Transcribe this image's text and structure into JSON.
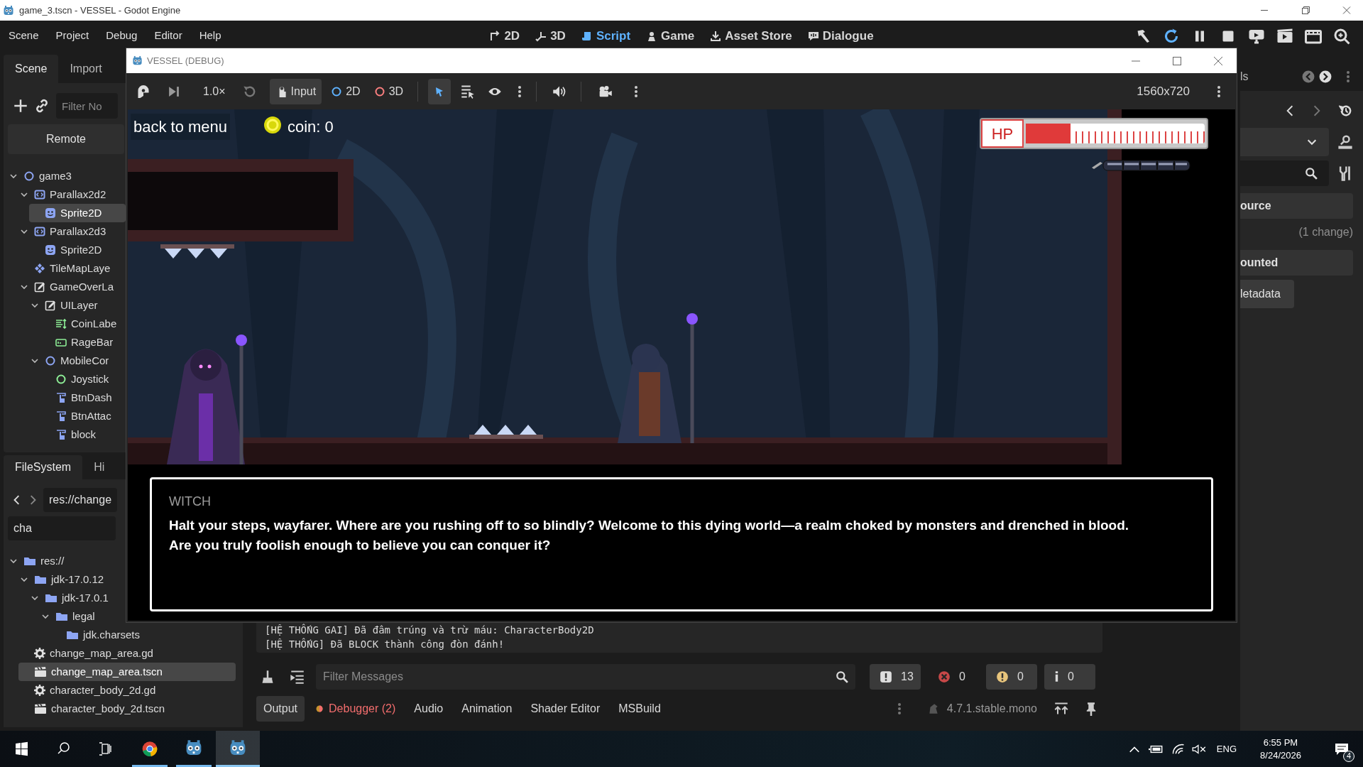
{
  "window": {
    "title": "game_3.tscn - VESSEL - Godot Engine"
  },
  "menu": [
    "Scene",
    "Project",
    "Debug",
    "Editor",
    "Help"
  ],
  "workspaces": [
    {
      "label": "2D",
      "kind": "flat",
      "selected": false
    },
    {
      "label": "3D",
      "kind": "space",
      "selected": false
    },
    {
      "label": "Script",
      "kind": "script",
      "selected": true
    },
    {
      "label": "Game",
      "kind": "game",
      "selected": false
    },
    {
      "label": "Asset Store",
      "kind": "store",
      "selected": false
    },
    {
      "label": "Dialogue",
      "kind": "dialogue",
      "selected": false
    }
  ],
  "scene_dock": {
    "tabs": [
      {
        "label": "Scene",
        "selected": true
      },
      {
        "label": "Import",
        "selected": false
      }
    ],
    "filter": {
      "placeholder": "Filter No"
    },
    "remote_button": "Remote",
    "tree": [
      {
        "label": "game3",
        "kind": "node2d",
        "selected": false,
        "expanded": true,
        "children": [
          {
            "label": "Parallax2d2",
            "kind": "parallax",
            "selected": false,
            "expanded": true,
            "children": [
              {
                "label": "Sprite2D",
                "kind": "sprite",
                "selected": true
              }
            ]
          },
          {
            "label": "Parallax2d3",
            "kind": "parallax",
            "selected": false,
            "expanded": true,
            "children": [
              {
                "label": "Sprite2D",
                "kind": "sprite",
                "selected": false
              }
            ]
          },
          {
            "label": "TileMapLaye",
            "kind": "tilemap",
            "selected": false
          },
          {
            "label": "GameOverLa",
            "kind": "canvas_layer",
            "selected": false,
            "expanded": true,
            "children": [
              {
                "label": "UILayer",
                "kind": "canvas_layer",
                "selected": false,
                "expanded": true,
                "children": [
                  {
                    "label": "CoinLabe",
                    "kind": "label",
                    "selected": false
                  },
                  {
                    "label": "RageBar",
                    "kind": "progress",
                    "selected": false
                  }
                ]
              },
              {
                "label": "MobileCor",
                "kind": "node2d",
                "selected": false,
                "expanded": true,
                "children": [
                  {
                    "label": "Joystick",
                    "kind": "control",
                    "selected": false
                  },
                  {
                    "label": "BtnDash",
                    "kind": "touch_button",
                    "selected": false
                  },
                  {
                    "label": "BtnAttac",
                    "kind": "touch_button",
                    "selected": false
                  },
                  {
                    "label": "block",
                    "kind": "touch_button",
                    "selected": false
                  }
                ]
              }
            ]
          }
        ]
      }
    ]
  },
  "filesystem": {
    "tabs": [
      {
        "label": "FileSystem",
        "selected": true
      },
      {
        "label": "Hi",
        "selected": false
      }
    ],
    "path": "res://change",
    "search": "cha",
    "tree": [
      {
        "label": "res://",
        "kind": "folder",
        "selected": false,
        "expanded": true,
        "children": [
          {
            "label": "jdk-17.0.12",
            "kind": "folder",
            "selected": false,
            "expanded": true,
            "children": [
              {
                "label": "jdk-17.0.1",
                "kind": "folder",
                "selected": false,
                "expanded": true,
                "children": [
                  {
                    "label": "legal",
                    "kind": "folder",
                    "selected": false,
                    "expanded": true,
                    "children": [
                      {
                        "label": "jdk.charsets",
                        "kind": "folder",
                        "selected": false
                      }
                    ]
                  }
                ]
              }
            ]
          },
          {
            "label": "change_map_area.gd",
            "kind": "script",
            "selected": false
          },
          {
            "label": "change_map_area.tscn",
            "kind": "scene",
            "selected": true
          },
          {
            "label": "character_body_2d.gd",
            "kind": "script",
            "selected": false
          },
          {
            "label": "character_body_2d.tscn",
            "kind": "scene",
            "selected": false
          }
        ]
      }
    ]
  },
  "debug_window": {
    "title": "VESSEL (DEBUG)",
    "toolbar": {
      "speed": "1.0×",
      "input_button": "Input",
      "mode_2d": "2D",
      "mode_3d": "3D",
      "resolution": "1560x720"
    },
    "game": {
      "back_button": "back to menu",
      "coin_label": "coin: 0",
      "hp": {
        "label": "HP",
        "level": 0.25
      },
      "dialogue": {
        "speaker": "WITCH",
        "text": "Halt your steps, wayfarer. Where are you rushing off to so blindly? Welcome to this dying world—a realm choked by monsters and drenched in blood. Are you truly foolish enough to believe you can conquer it?"
      }
    }
  },
  "output": {
    "log": [
      "[HỆ THỐNG GAI] Đã đâm trúng và trừ máu: CharacterBody2D",
      "[HỆ THỐNG] Đã BLOCK thành công đòn đánh!"
    ],
    "filter": {
      "placeholder": "Filter Messages"
    },
    "counters": [
      {
        "kind": "message",
        "count": "13",
        "on": true
      },
      {
        "kind": "error",
        "count": "0",
        "on": false
      },
      {
        "kind": "warning",
        "count": "0",
        "on": true
      },
      {
        "kind": "info",
        "count": "0",
        "on": true
      }
    ],
    "tabs": [
      {
        "label": "Output",
        "selected": true,
        "alert": false
      },
      {
        "label": "Debugger (2)",
        "selected": false,
        "alert": true
      },
      {
        "label": "Audio",
        "selected": false,
        "alert": false
      },
      {
        "label": "Animation",
        "selected": false,
        "alert": false
      },
      {
        "label": "Shader Editor",
        "selected": false,
        "alert": false
      },
      {
        "label": "MSBuild",
        "selected": false,
        "alert": false
      }
    ],
    "version": "4.7.1.stable.mono"
  },
  "right_dock": {
    "tab": "ls",
    "sections": [
      {
        "kind": "header",
        "text": "ource"
      },
      {
        "kind": "note",
        "text": "(1 change)"
      },
      {
        "kind": "header",
        "text": "ounted"
      },
      {
        "kind": "button",
        "text": "letadata"
      }
    ]
  },
  "taskbar": {
    "apps": [
      {
        "kind": "chrome",
        "selected": false
      },
      {
        "kind": "godot",
        "selected": false
      },
      {
        "kind": "godot",
        "selected": true
      }
    ],
    "language": "ENG",
    "time": "6:55 PM",
    "date": "8/24/2026",
    "notifications": "4"
  }
}
